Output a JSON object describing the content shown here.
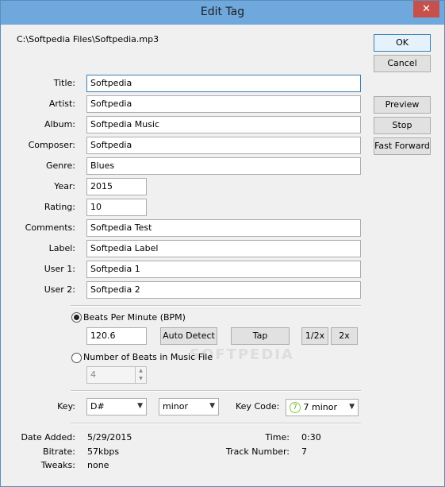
{
  "window": {
    "title": "Edit Tag",
    "close_glyph": "✕"
  },
  "file_path": "C:\\Softpedia Files\\Softpedia.mp3",
  "buttons": {
    "ok": "OK",
    "cancel": "Cancel",
    "preview": "Preview",
    "stop": "Stop",
    "fast_forward": "Fast Forward",
    "auto_detect": "Auto Detect",
    "tap": "Tap",
    "half": "1/2x",
    "double": "2x"
  },
  "fields": {
    "title": {
      "label": "Title:",
      "value": "Softpedia"
    },
    "artist": {
      "label": "Artist:",
      "value": "Softpedia"
    },
    "album": {
      "label": "Album:",
      "value": "Softpedia Music"
    },
    "composer": {
      "label": "Composer:",
      "value": "Softpedia"
    },
    "genre": {
      "label": "Genre:",
      "value": "Blues"
    },
    "year": {
      "label": "Year:",
      "value": "2015"
    },
    "rating": {
      "label": "Rating:",
      "value": "10"
    },
    "comments": {
      "label": "Comments:",
      "value": "Softpedia Test"
    },
    "label": {
      "label": "Label:",
      "value": "Softpedia Label"
    },
    "user1": {
      "label": "User 1:",
      "value": "Softpedia 1"
    },
    "user2": {
      "label": "User 2:",
      "value": "Softpedia 2"
    }
  },
  "bpm": {
    "option_bpm": "Beats Per Minute (BPM)",
    "bpm_value": "120.6",
    "option_beats": "Number of Beats in Music File",
    "beats_value": "4",
    "selected": "bpm"
  },
  "key": {
    "label": "Key:",
    "note": "D#",
    "mode": "minor",
    "code_label": "Key Code:",
    "code_value": "7 minor",
    "code_badge": "7",
    "badge_color": "#8ac840"
  },
  "info": {
    "date_added_label": "Date Added:",
    "date_added": "5/29/2015",
    "bitrate_label": "Bitrate:",
    "bitrate": "57kbps",
    "tweaks_label": "Tweaks:",
    "tweaks": "none",
    "time_label": "Time:",
    "time": "0:30",
    "track_label": "Track Number:",
    "track": "7"
  },
  "watermark": "SOFTPEDIA"
}
